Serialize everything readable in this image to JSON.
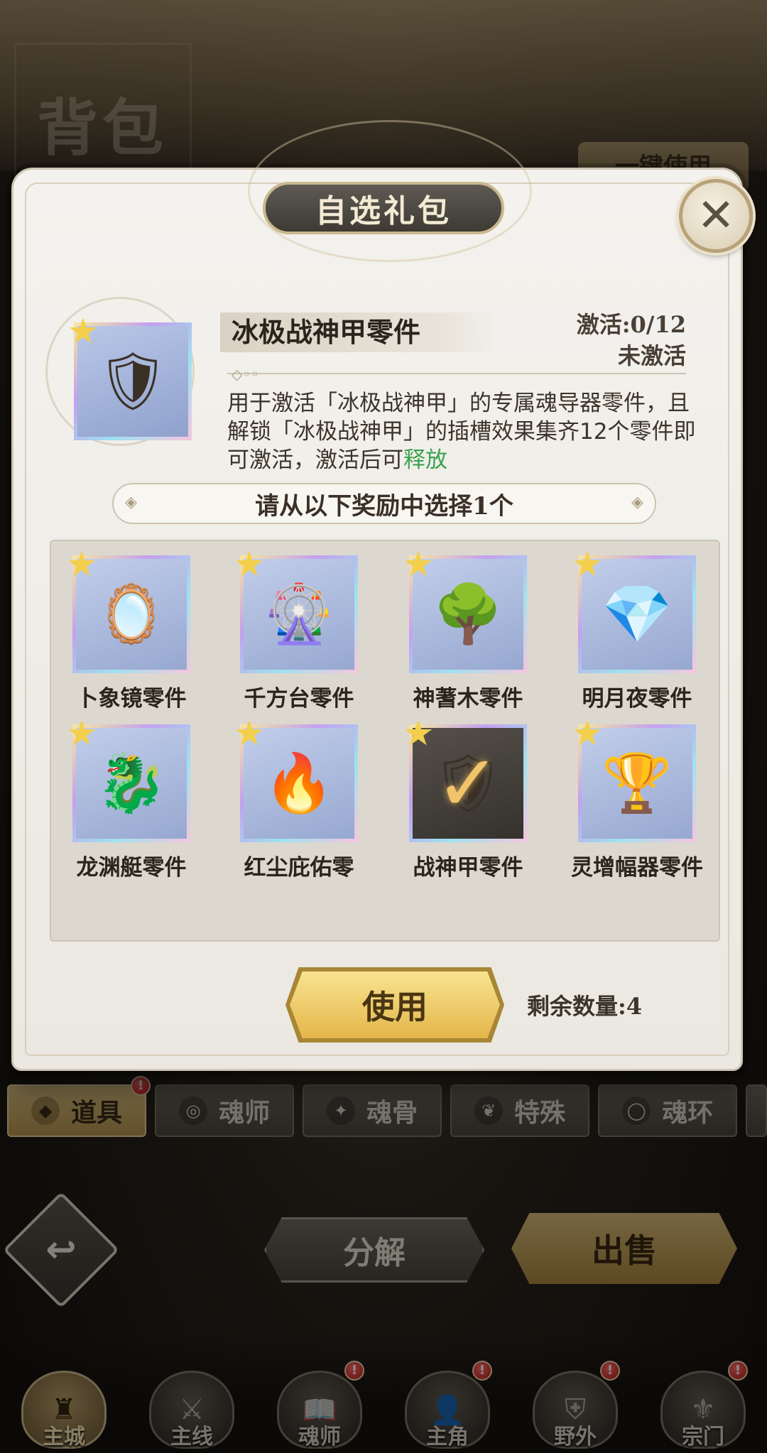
{
  "background": {
    "bag_title": "背包",
    "one_key_use": "一键使用"
  },
  "modal": {
    "title": "自选礼包",
    "close_icon": "close-icon",
    "item": {
      "name": "冰极战神甲零件",
      "activation_count": "激活:0/12",
      "activation_status": "未激活",
      "description_main": "用于激活「冰极战神甲」的专属魂导器零件，且解锁「冰极战神甲」的插槽效果集齐12个零件即可激活，激活后可",
      "description_highlight": "释放"
    },
    "choose_prompt": "请从以下奖励中选择1个",
    "rewards": [
      {
        "label": "卜象镜零件",
        "icon": "🪞",
        "selected": false
      },
      {
        "label": "千方台零件",
        "icon": "🎡",
        "selected": false
      },
      {
        "label": "神蓍木零件",
        "icon": "🌳",
        "selected": false
      },
      {
        "label": "明月夜零件",
        "icon": "💎",
        "selected": false
      },
      {
        "label": "龙渊艇零件",
        "icon": "🐉",
        "selected": false
      },
      {
        "label": "红尘庇佑零",
        "icon": "🔥",
        "selected": false
      },
      {
        "label": "战神甲零件",
        "icon": "🛡",
        "selected": true
      },
      {
        "label": "灵增幅器零件",
        "icon": "🏆",
        "selected": false
      }
    ],
    "use_button": "使用",
    "remaining": "剩余数量:4"
  },
  "category_tabs": [
    {
      "label": "道具",
      "icon": "◆",
      "active": true,
      "badge": "!"
    },
    {
      "label": "魂师",
      "icon": "◎",
      "active": false,
      "badge": ""
    },
    {
      "label": "魂骨",
      "icon": "✦",
      "active": false,
      "badge": ""
    },
    {
      "label": "特殊",
      "icon": "❦",
      "active": false,
      "badge": ""
    },
    {
      "label": "魂环",
      "icon": "◯",
      "active": false,
      "badge": ""
    }
  ],
  "actions": {
    "back_icon": "back-arrow-icon",
    "decompose": "分解",
    "sell": "出售"
  },
  "bottom_nav": [
    {
      "label": "主城",
      "icon": "♜",
      "active": true,
      "badge": ""
    },
    {
      "label": "主线",
      "icon": "⚔",
      "active": false,
      "badge": ""
    },
    {
      "label": "魂师",
      "icon": "📖",
      "active": false,
      "badge": "!"
    },
    {
      "label": "主角",
      "icon": "👤",
      "active": false,
      "badge": "!"
    },
    {
      "label": "野外",
      "icon": "⛨",
      "active": false,
      "badge": "!"
    },
    {
      "label": "宗门",
      "icon": "⚜",
      "active": false,
      "badge": "!"
    }
  ]
}
